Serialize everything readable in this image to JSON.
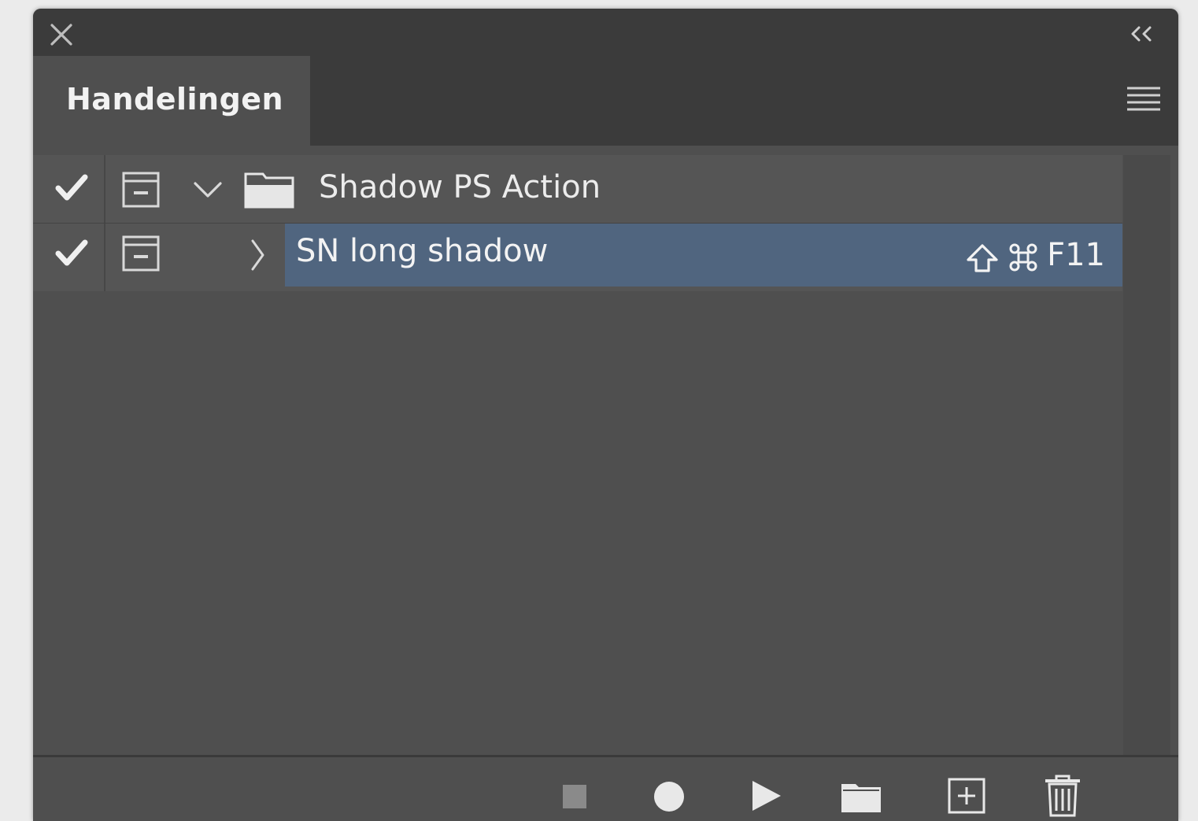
{
  "panel": {
    "tab_label": "Handelingen"
  },
  "actions": {
    "set": {
      "label": "Shadow PS Action",
      "checked": true,
      "expanded": true
    },
    "action": {
      "label": "SN long shadow",
      "checked": true,
      "expanded": false,
      "selected": true,
      "shortcut_key": "F11"
    }
  },
  "icons": {
    "close": "close-icon",
    "collapse": "double-chevron-left-icon",
    "menu": "hamburger-menu-icon",
    "check": "checkmark-icon",
    "dialog": "dialog-toggle-icon",
    "folder": "folder-icon",
    "shift": "shift-icon",
    "command": "command-icon",
    "stop": "stop-icon",
    "record": "record-icon",
    "play": "play-icon",
    "new_set": "new-set-icon",
    "new_action": "new-action-icon",
    "delete": "trash-icon"
  },
  "colors": {
    "panel_bg": "#4f4f4f",
    "header_bg": "#3b3b3b",
    "selection": "#50657f",
    "text": "#ececec"
  }
}
